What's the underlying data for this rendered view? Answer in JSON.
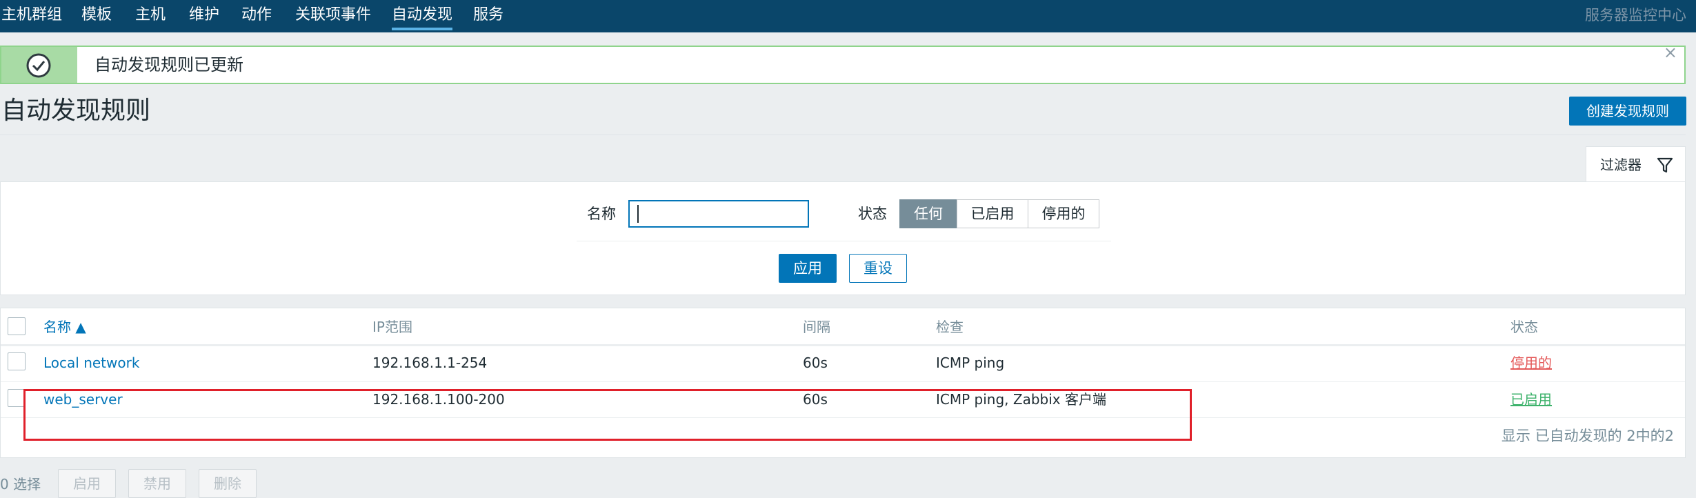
{
  "nav": {
    "items": [
      "主机群组",
      "模板",
      "主机",
      "维护",
      "动作",
      "关联项事件",
      "自动发现",
      "服务"
    ],
    "active": "自动发现",
    "right_text": "服务器监控中心"
  },
  "message": {
    "text": "自动发现规则已更新",
    "close": "×"
  },
  "page": {
    "title": "自动发现规则",
    "create_button": "创建发现规则"
  },
  "filter": {
    "tab_label": "过滤器",
    "name_label": "名称",
    "name_value": "",
    "status_label": "状态",
    "status_options": [
      "任何",
      "已启用",
      "停用的"
    ],
    "status_selected": "任何",
    "apply": "应用",
    "reset": "重设"
  },
  "table": {
    "columns": [
      "名称 ▲",
      "IP范围",
      "间隔",
      "检查",
      "状态"
    ],
    "rows": [
      {
        "name": "Local network",
        "ip_range": "192.168.1.1-254",
        "interval": "60s",
        "checks": "ICMP ping",
        "status": "停用的"
      },
      {
        "name": "web_server",
        "ip_range": "192.168.1.100-200",
        "interval": "60s",
        "checks": "ICMP ping, Zabbix 客户端",
        "status": "已启用"
      }
    ],
    "footer": "显示 已自动发现的 2中的2"
  },
  "bottom": {
    "selected": "0 选择",
    "buttons": [
      "启用",
      "禁用",
      "删除"
    ]
  },
  "colors": {
    "nav_bg": "#0a466a",
    "accent": "#0275b8",
    "success": "#8fd48c",
    "disabled_status": "#e45959",
    "enabled_status": "#3db26b"
  }
}
